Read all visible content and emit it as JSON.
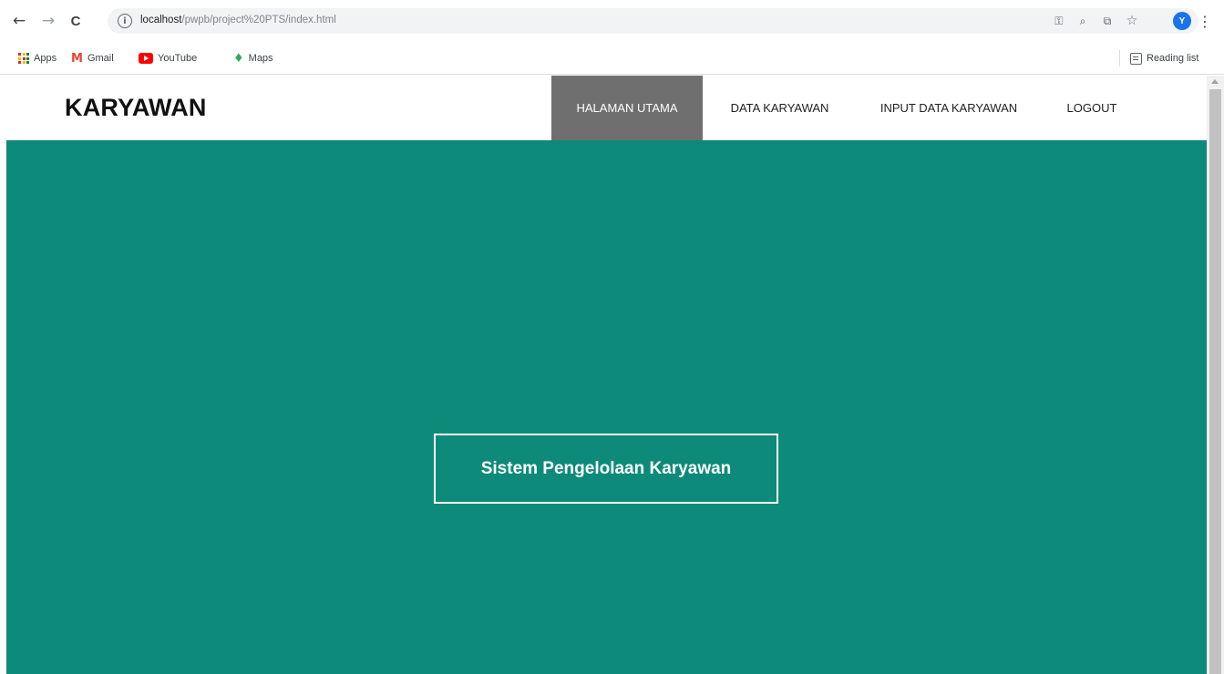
{
  "browser": {
    "url_host": "localhost",
    "url_path": "/pwpb/project%20PTS/index.html",
    "avatar_letter": "Y",
    "icons": {
      "back": "←",
      "forward": "→",
      "reload": "C",
      "info": "i",
      "key": "⚿",
      "zoom": "⌕",
      "share": "⧉",
      "star": "☆",
      "menu": "⋮"
    },
    "bookmarks": [
      {
        "label": "Apps"
      },
      {
        "label": "Gmail"
      },
      {
        "label": "YouTube"
      },
      {
        "label": "Maps"
      }
    ],
    "reading_list": "Reading list"
  },
  "site": {
    "brand": "KARYAWAN",
    "menu": [
      {
        "label": "HALAMAN UTAMA",
        "active": true
      },
      {
        "label": "DATA KARYAWAN",
        "active": false
      },
      {
        "label": "INPUT DATA KARYAWAN",
        "active": false
      },
      {
        "label": "LOGOUT",
        "active": false
      }
    ],
    "hero_title": "Sistem Pengelolaan Karyawan"
  },
  "colors": {
    "hero_bg": "#0d8a7a",
    "active_menu_bg": "#6f6f6f",
    "avatar_bg": "#1a73e8"
  }
}
